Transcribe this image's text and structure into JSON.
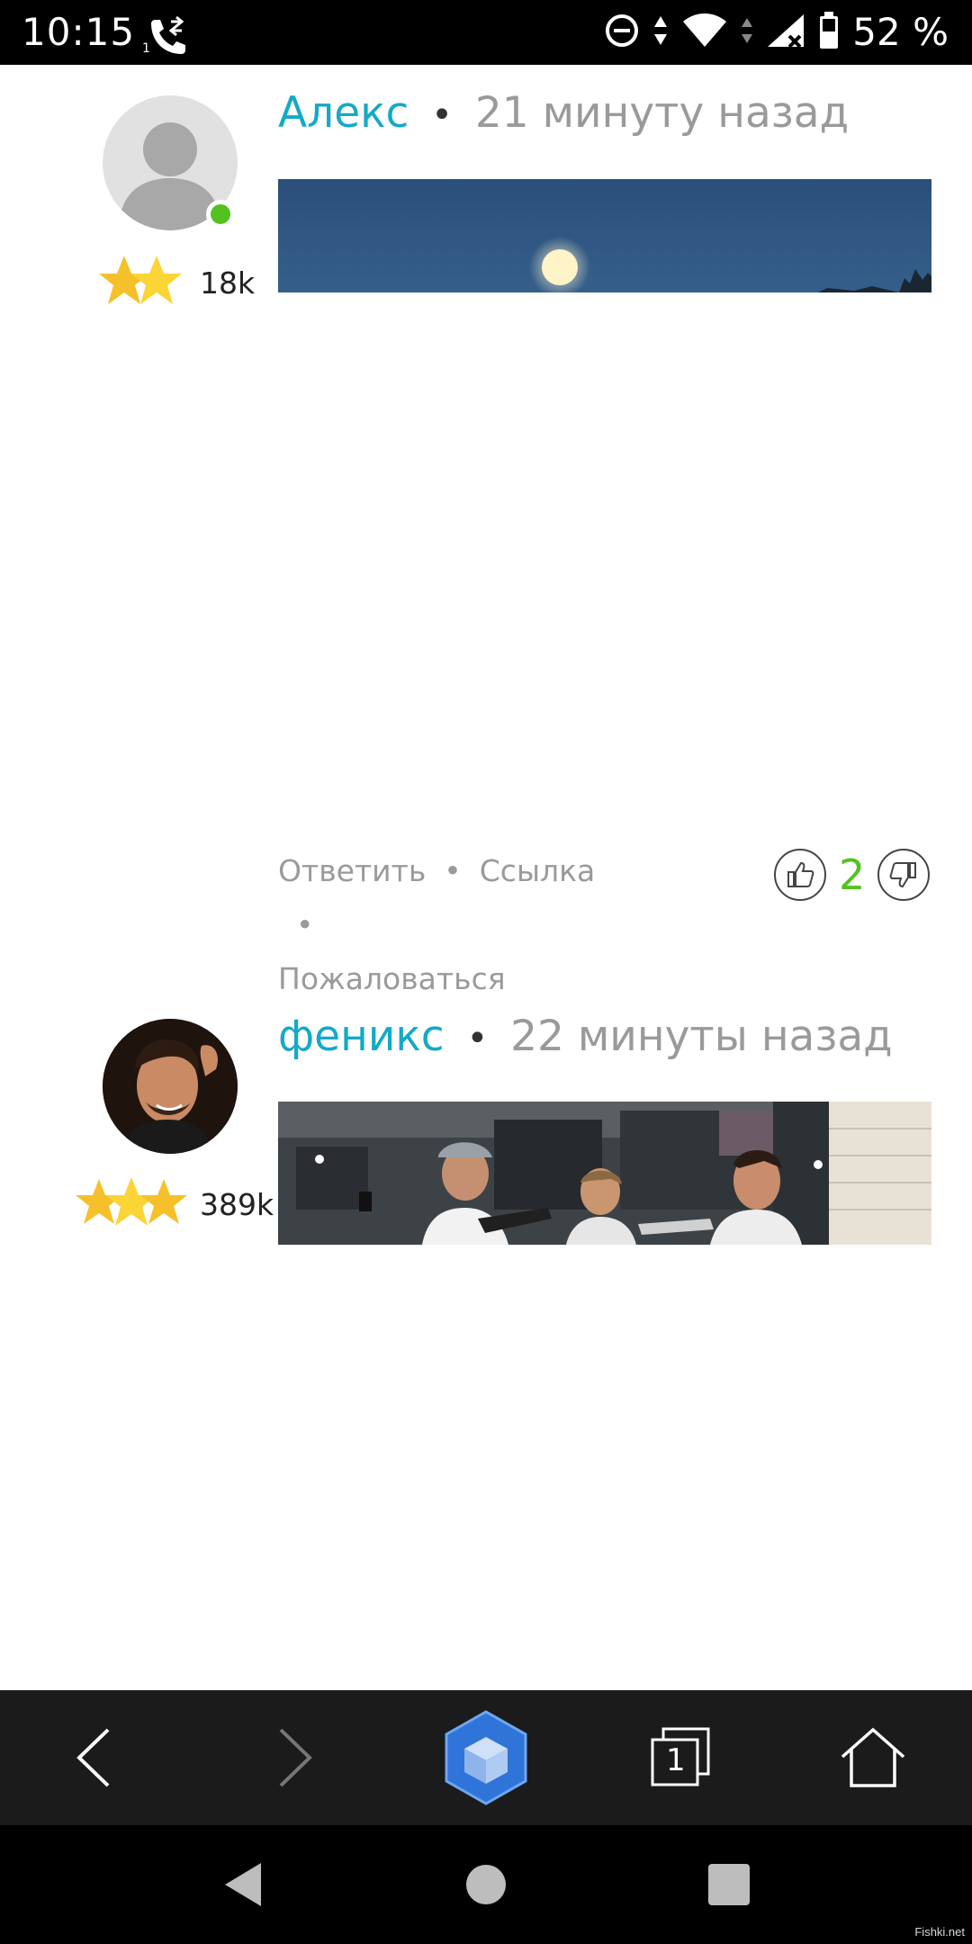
{
  "status_bar": {
    "time": "10:15",
    "call_sim": "1",
    "battery_text": "52 %",
    "icons": [
      "call-forward-icon",
      "dnd-icon",
      "data-arrows-icon",
      "wifi-icon",
      "signal-icon",
      "battery-icon"
    ]
  },
  "comments": [
    {
      "author": "Алекс",
      "separator": "•",
      "time_ago": "21 минуту назад",
      "avatar": "default-user-avatar",
      "online": true,
      "stars": 2,
      "rating_value": "18k",
      "media": "night-sky-moon-photo",
      "actions": {
        "reply": "Ответить",
        "link": "Ссылка",
        "report": "Пожаловаться",
        "sep": "•"
      },
      "votes": "2"
    },
    {
      "author": "феникс",
      "separator": "•",
      "time_ago": "22 минуты назад",
      "avatar": "user-photo-avatar",
      "online": false,
      "stars": 3,
      "rating_value": "389k",
      "media": "street-scene-photo"
    }
  ],
  "browser_toolbar": {
    "tabs_count": "1",
    "icons": [
      "back-icon",
      "forward-icon",
      "cube-logo-icon",
      "tabs-icon",
      "home-icon"
    ]
  },
  "nav_bar": {
    "icons": [
      "nav-back-icon",
      "nav-home-icon",
      "nav-recents-icon"
    ]
  },
  "watermark": "Fishki.net",
  "colors": {
    "author": "#15a9c6",
    "online": "#53c21e",
    "votes": "#53c21e",
    "muted_text": "#9a9a9a"
  }
}
